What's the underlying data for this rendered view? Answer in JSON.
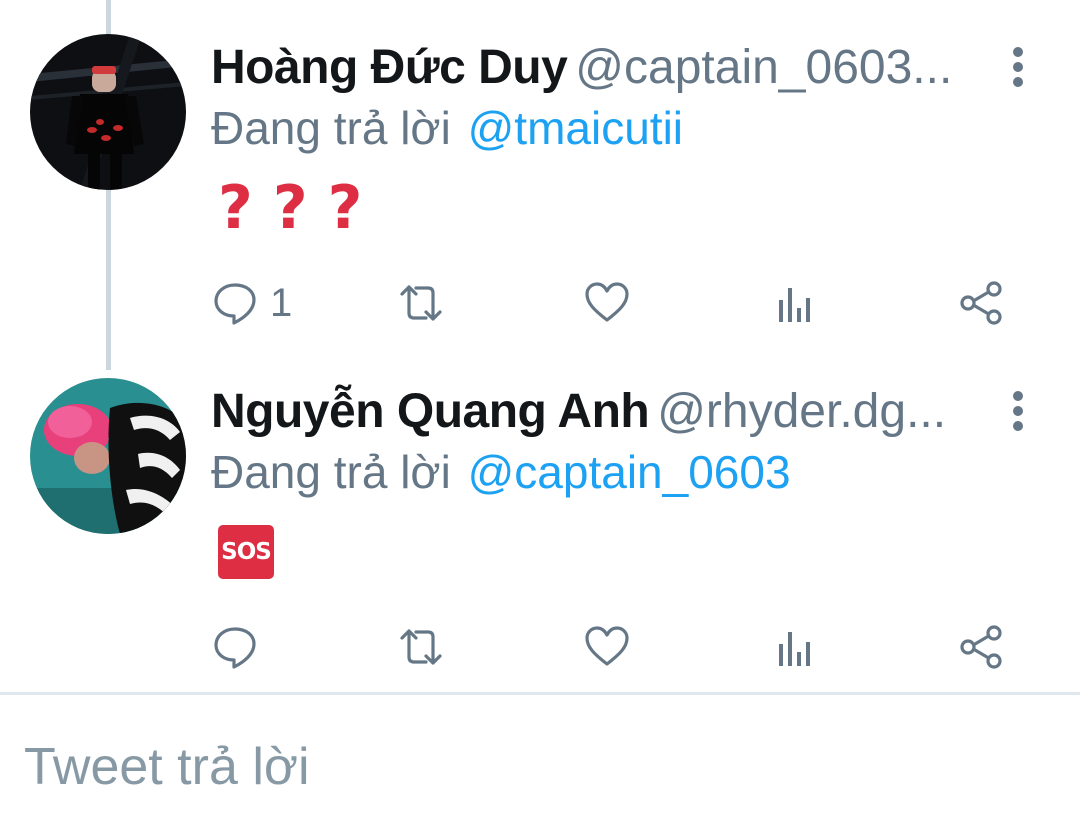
{
  "tweets": [
    {
      "name": "Hoàng Đức Duy",
      "handle": "@captain_0603...",
      "reply_prefix": "Đang trả lời",
      "reply_to": "@tmaicutii",
      "content_icons": [
        "question-mark",
        "question-mark",
        "question-mark"
      ],
      "reply_count": "1"
    },
    {
      "name": "Nguyễn Quang Anh",
      "handle": "@rhyder.dg...",
      "reply_prefix": "Đang trả lời",
      "reply_to": "@captain_0603",
      "content_icons": [
        "sos"
      ],
      "sos_text": "SOS",
      "reply_count": ""
    }
  ],
  "reply_box": {
    "placeholder": "Tweet trả lời"
  },
  "colors": {
    "accent": "#1da1f2",
    "secondary_text": "#657786",
    "emoji_red": "#dd2e44"
  }
}
